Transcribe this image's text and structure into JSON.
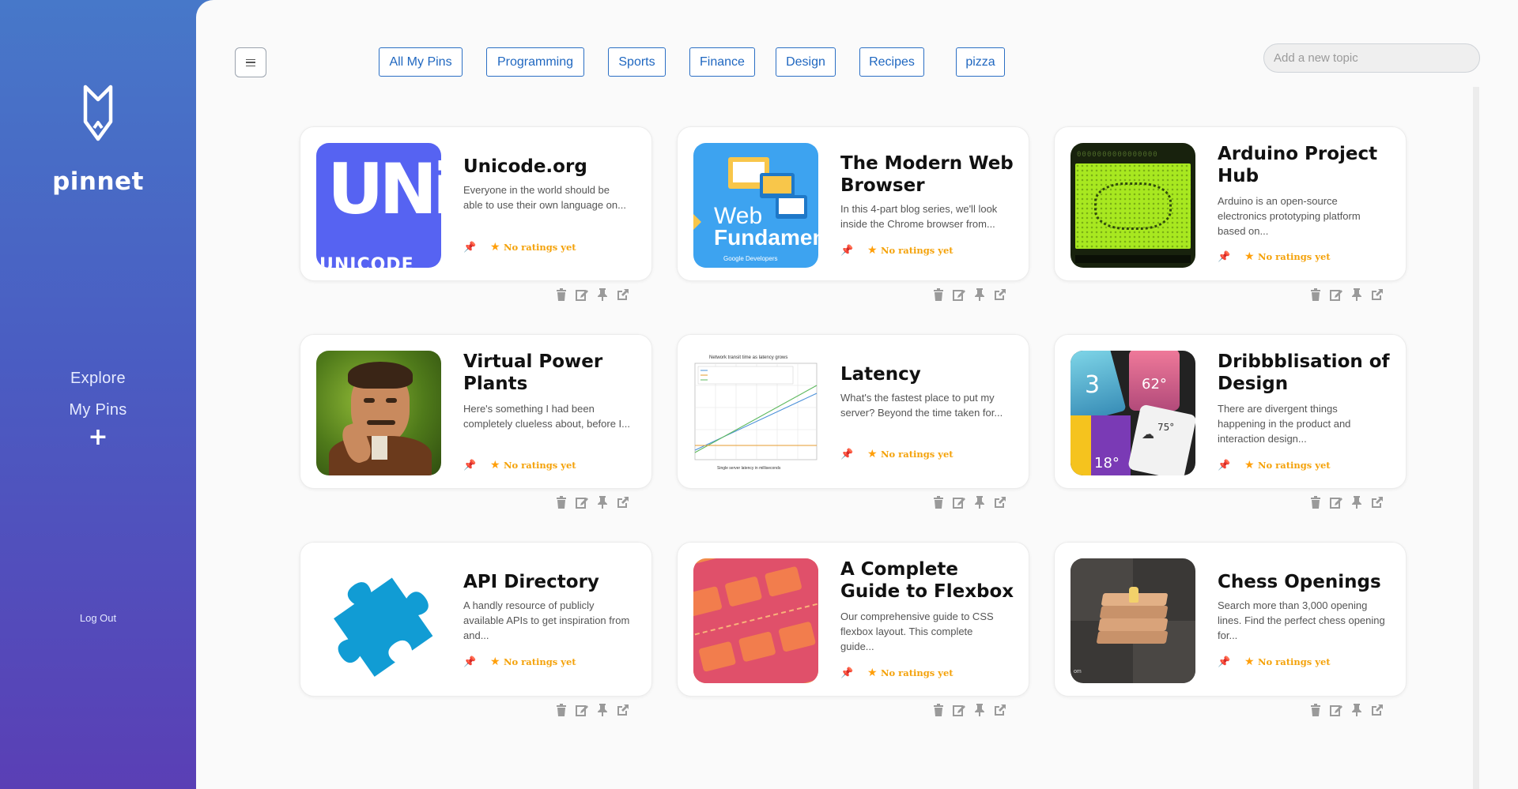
{
  "brand": {
    "name": "pinnet",
    "icon": "pin-shield-logo-icon"
  },
  "sidebar": {
    "nav": [
      {
        "label": "Explore"
      },
      {
        "label": "My Pins"
      }
    ],
    "add_label": "+",
    "logout_label": "Log Out"
  },
  "header": {
    "menu_icon": "hamburger-menu-icon",
    "topics": [
      {
        "label": "All My Pins"
      },
      {
        "label": "Programming"
      },
      {
        "label": "Sports"
      },
      {
        "label": "Finance"
      },
      {
        "label": "Design"
      },
      {
        "label": "Recipes"
      },
      {
        "label": "pizza"
      }
    ],
    "topic_input": {
      "placeholder": "Add a new topic",
      "value": ""
    }
  },
  "colors": {
    "sidebar_gradient_top": "#4778c9",
    "sidebar_gradient_bottom": "#5a3fb5",
    "topic_border": "#2b6fc4",
    "rating_text": "#f4a20a",
    "pin": "#d22e5a"
  },
  "cards": [
    {
      "title": "Unicode.org",
      "description": "Everyone in the world should be able to use their own language on...",
      "rating": "No ratings yet",
      "thumb": "unicode-logo"
    },
    {
      "title": "The Modern Web Browser",
      "description": "In this 4-part blog series, we'll look inside the Chrome browser from...",
      "rating": "No ratings yet",
      "thumb": "web-fundamentals"
    },
    {
      "title": "Arduino Project Hub",
      "description": "Arduino is an open-source electronics prototyping platform based on...",
      "rating": "No ratings yet",
      "thumb": "lcd-display"
    },
    {
      "title": "Virtual Power Plants",
      "description": "Here's something I had been completely clueless about, before I...",
      "rating": "No ratings yet",
      "thumb": "tesla-portrait"
    },
    {
      "title": "Latency",
      "description": "What's the fastest place to put my server? Beyond the time taken for...",
      "rating": "No ratings yet",
      "thumb": "latency-chart"
    },
    {
      "title": "Dribbblisation of Design",
      "description": "There are divergent things happening in the product and interaction design...",
      "rating": "No ratings yet",
      "thumb": "weather-app-ui"
    },
    {
      "title": "API Directory",
      "description": "A handly resource of publicly available APIs to get inspiration from and...",
      "rating": "No ratings yet",
      "thumb": "puzzle-piece"
    },
    {
      "title": "A Complete Guide to Flexbox",
      "description": "Our comprehensive guide to CSS flexbox layout. This complete guide...",
      "rating": "No ratings yet",
      "thumb": "flexbox-boxes"
    },
    {
      "title": "Chess Openings",
      "description": "Search more than 3,000 opening lines. Find the perfect chess opening for...",
      "rating": "No ratings yet",
      "thumb": "chess-books"
    }
  ],
  "thumb_text": {
    "unicode_top": "UNi",
    "unicode_bottom": "UNICODE",
    "web_top": "Web",
    "web_bottom": "Fundamenta",
    "web_google": "Google Developers",
    "latency_title": "Network transit time as latency grows",
    "latency_x": "Single server latency in milliseconds",
    "lcd_row": "0000000000000000",
    "weather_big": "3",
    "weather_62": "62°",
    "weather_18": "18°",
    "weather_75": "75°",
    "chess_corner": "om"
  },
  "card_actions": [
    "trash-icon",
    "edit-icon",
    "pin-icon",
    "external-link-icon"
  ]
}
